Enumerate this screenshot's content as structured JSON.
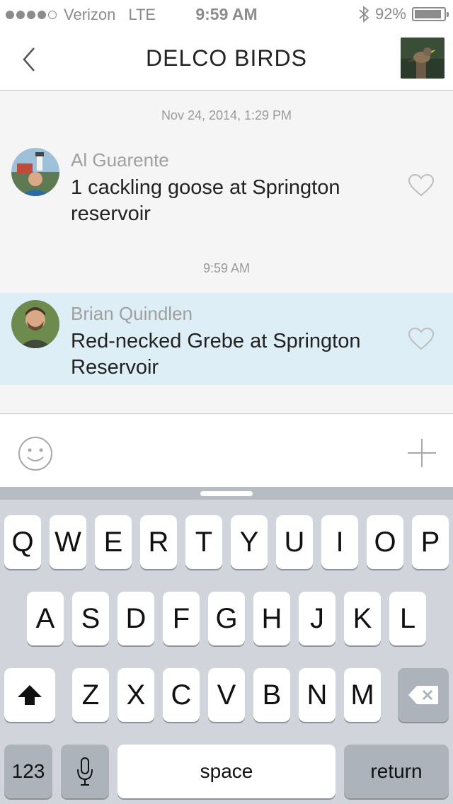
{
  "status_bar": {
    "carrier": "Verizon",
    "network": "LTE",
    "time": "9:59 AM",
    "battery": "92%",
    "battery_level": 0.92,
    "signal_bars": 4
  },
  "nav": {
    "title": "DELCO BIRDS"
  },
  "chat": {
    "timestamps": [
      "Nov 24, 2014, 1:29 PM",
      "9:59 AM"
    ],
    "messages": [
      {
        "author": "Al Guarente",
        "text": "1 cackling goose at Springton reservoir"
      },
      {
        "author": "Brian Quindlen",
        "text": "Red-necked Grebe at Springton Reservoir"
      }
    ]
  },
  "keyboard": {
    "row1": [
      "Q",
      "W",
      "E",
      "R",
      "T",
      "Y",
      "U",
      "I",
      "O",
      "P"
    ],
    "row2": [
      "A",
      "S",
      "D",
      "F",
      "G",
      "H",
      "J",
      "K",
      "L"
    ],
    "row3": [
      "Z",
      "X",
      "C",
      "V",
      "B",
      "N",
      "M"
    ],
    "numbers_key": "123",
    "space_key": "space",
    "return_key": "return"
  },
  "colors": {
    "highlight": "#ddeef6",
    "keyboard_bg": "#d1d5db",
    "secondary_text": "#a0a0a0"
  },
  "icons": [
    "back-chevron-icon",
    "bluetooth-icon",
    "heart-outline-icon",
    "smiley-icon",
    "plus-icon",
    "shift-arrow-icon",
    "backspace-icon",
    "microphone-icon"
  ]
}
